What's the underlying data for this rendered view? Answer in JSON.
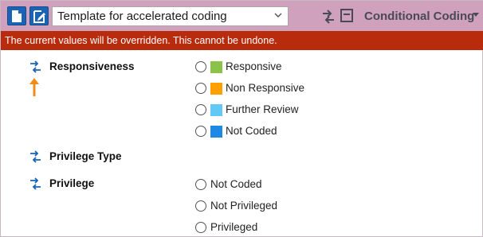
{
  "toolbar": {
    "template_select": {
      "value": "Template for accelerated coding"
    },
    "mode_label": "Conditional Coding",
    "icons": [
      "new-document-icon",
      "edit-document-icon",
      "swap-arrows-icon",
      "collapse-panel-icon",
      "caret-down-icon"
    ]
  },
  "warning": {
    "text": "The current values will be overridden. This cannot be undone.",
    "color": "#b82b0d"
  },
  "fields": [
    {
      "label": "Responsiveness",
      "options": [
        {
          "label": "Responsive",
          "color": "#8bc34a"
        },
        {
          "label": "Non Responsive",
          "color": "#ffa000"
        },
        {
          "label": "Further Review",
          "color": "#64c8f5"
        },
        {
          "label": "Not Coded",
          "color": "#1e88e5"
        }
      ]
    },
    {
      "label": "Privilege Type",
      "options": []
    },
    {
      "label": "Privilege",
      "options": [
        {
          "label": "Not Coded"
        },
        {
          "label": "Not Privileged"
        },
        {
          "label": "Privileged"
        }
      ]
    }
  ],
  "colors": {
    "toolbar_bg": "#cfa1bd",
    "accent_blue": "#1b63b5",
    "annotation_arrow": "#f28c18"
  }
}
